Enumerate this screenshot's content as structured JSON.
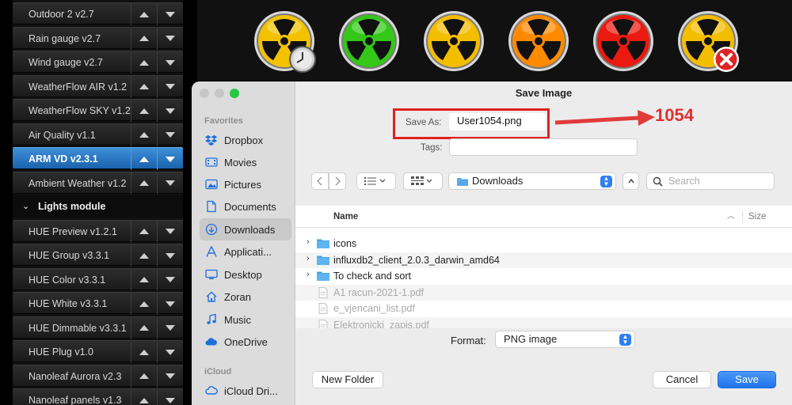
{
  "modules": {
    "rows": [
      {
        "label": "Outdoor 2 v2.7"
      },
      {
        "label": "Rain gauge v2.7"
      },
      {
        "label": "Wind gauge v2.7"
      },
      {
        "label": "WeatherFlow AIR v1.2"
      },
      {
        "label": "WeatherFlow SKY v1.2"
      },
      {
        "label": "Air Quality v1.1"
      },
      {
        "label": "ARM VD v2.3.1",
        "selected": true
      },
      {
        "label": "Ambient Weather v1.2"
      }
    ],
    "section": {
      "label": "Lights module"
    },
    "rows2": [
      {
        "label": "HUE Preview v1.2.1"
      },
      {
        "label": "HUE Group v3.3.1"
      },
      {
        "label": "HUE Color v3.3.1"
      },
      {
        "label": "HUE White v3.3.1"
      },
      {
        "label": "HUE Dimmable v3.3.1"
      },
      {
        "label": "HUE Plug v1.0"
      },
      {
        "label": "Nanoleaf Aurora v2.3"
      },
      {
        "label": "Nanoleaf panels v1.3"
      }
    ]
  },
  "icons": [
    {
      "name": "radiation-yellow-clock-icon",
      "color": "#f2c200",
      "badge": "clock"
    },
    {
      "name": "radiation-green-icon",
      "color": "#34c618",
      "badge": ""
    },
    {
      "name": "radiation-yellow-icon",
      "color": "#f3bd00",
      "badge": ""
    },
    {
      "name": "radiation-orange-icon",
      "color": "#ff8a00",
      "badge": ""
    },
    {
      "name": "radiation-red-icon",
      "color": "#ea1a10",
      "badge": ""
    },
    {
      "name": "radiation-yellow-error-icon",
      "color": "#f3bd00",
      "badge": "error"
    }
  ],
  "dialog": {
    "title": "Save Image",
    "save_as_label": "Save As:",
    "save_as_value": "User1054.png",
    "tags_label": "Tags:",
    "annotation": "1054",
    "location": "Downloads",
    "search_placeholder": "Search",
    "sidebar": {
      "favorites_head": "Favorites",
      "items": [
        {
          "label": "Dropbox",
          "icon": "dropbox-icon"
        },
        {
          "label": "Movies",
          "icon": "movies-icon"
        },
        {
          "label": "Pictures",
          "icon": "pictures-icon"
        },
        {
          "label": "Documents",
          "icon": "documents-icon"
        },
        {
          "label": "Downloads",
          "icon": "downloads-icon",
          "active": true
        },
        {
          "label": "Applicati...",
          "icon": "applications-icon"
        },
        {
          "label": "Desktop",
          "icon": "desktop-icon"
        },
        {
          "label": "Zoran",
          "icon": "home-icon"
        },
        {
          "label": "Music",
          "icon": "music-icon"
        },
        {
          "label": "OneDrive",
          "icon": "onedrive-icon"
        }
      ],
      "icloud_head": "iCloud",
      "icloud_item": "iCloud Dri..."
    },
    "columns": {
      "name": "Name",
      "size": "Size"
    },
    "files": [
      {
        "name": "icons",
        "kind": "folder"
      },
      {
        "name": "influxdb2_client_2.0.3_darwin_amd64",
        "kind": "folder"
      },
      {
        "name": "To check and sort",
        "kind": "folder"
      },
      {
        "name": "A1 racun-2021-1.pdf",
        "kind": "file"
      },
      {
        "name": "e_vjencani_list.pdf",
        "kind": "file"
      },
      {
        "name": "Elektronicki_zapis.pdf",
        "kind": "file"
      }
    ],
    "format_label": "Format:",
    "format_value": "PNG image",
    "new_folder": "New Folder",
    "cancel": "Cancel",
    "save": "Save"
  },
  "colors": {
    "accent_blue": "#2f7ff0",
    "annotation_red": "#e02020",
    "selected_row": "#1b62ad"
  }
}
